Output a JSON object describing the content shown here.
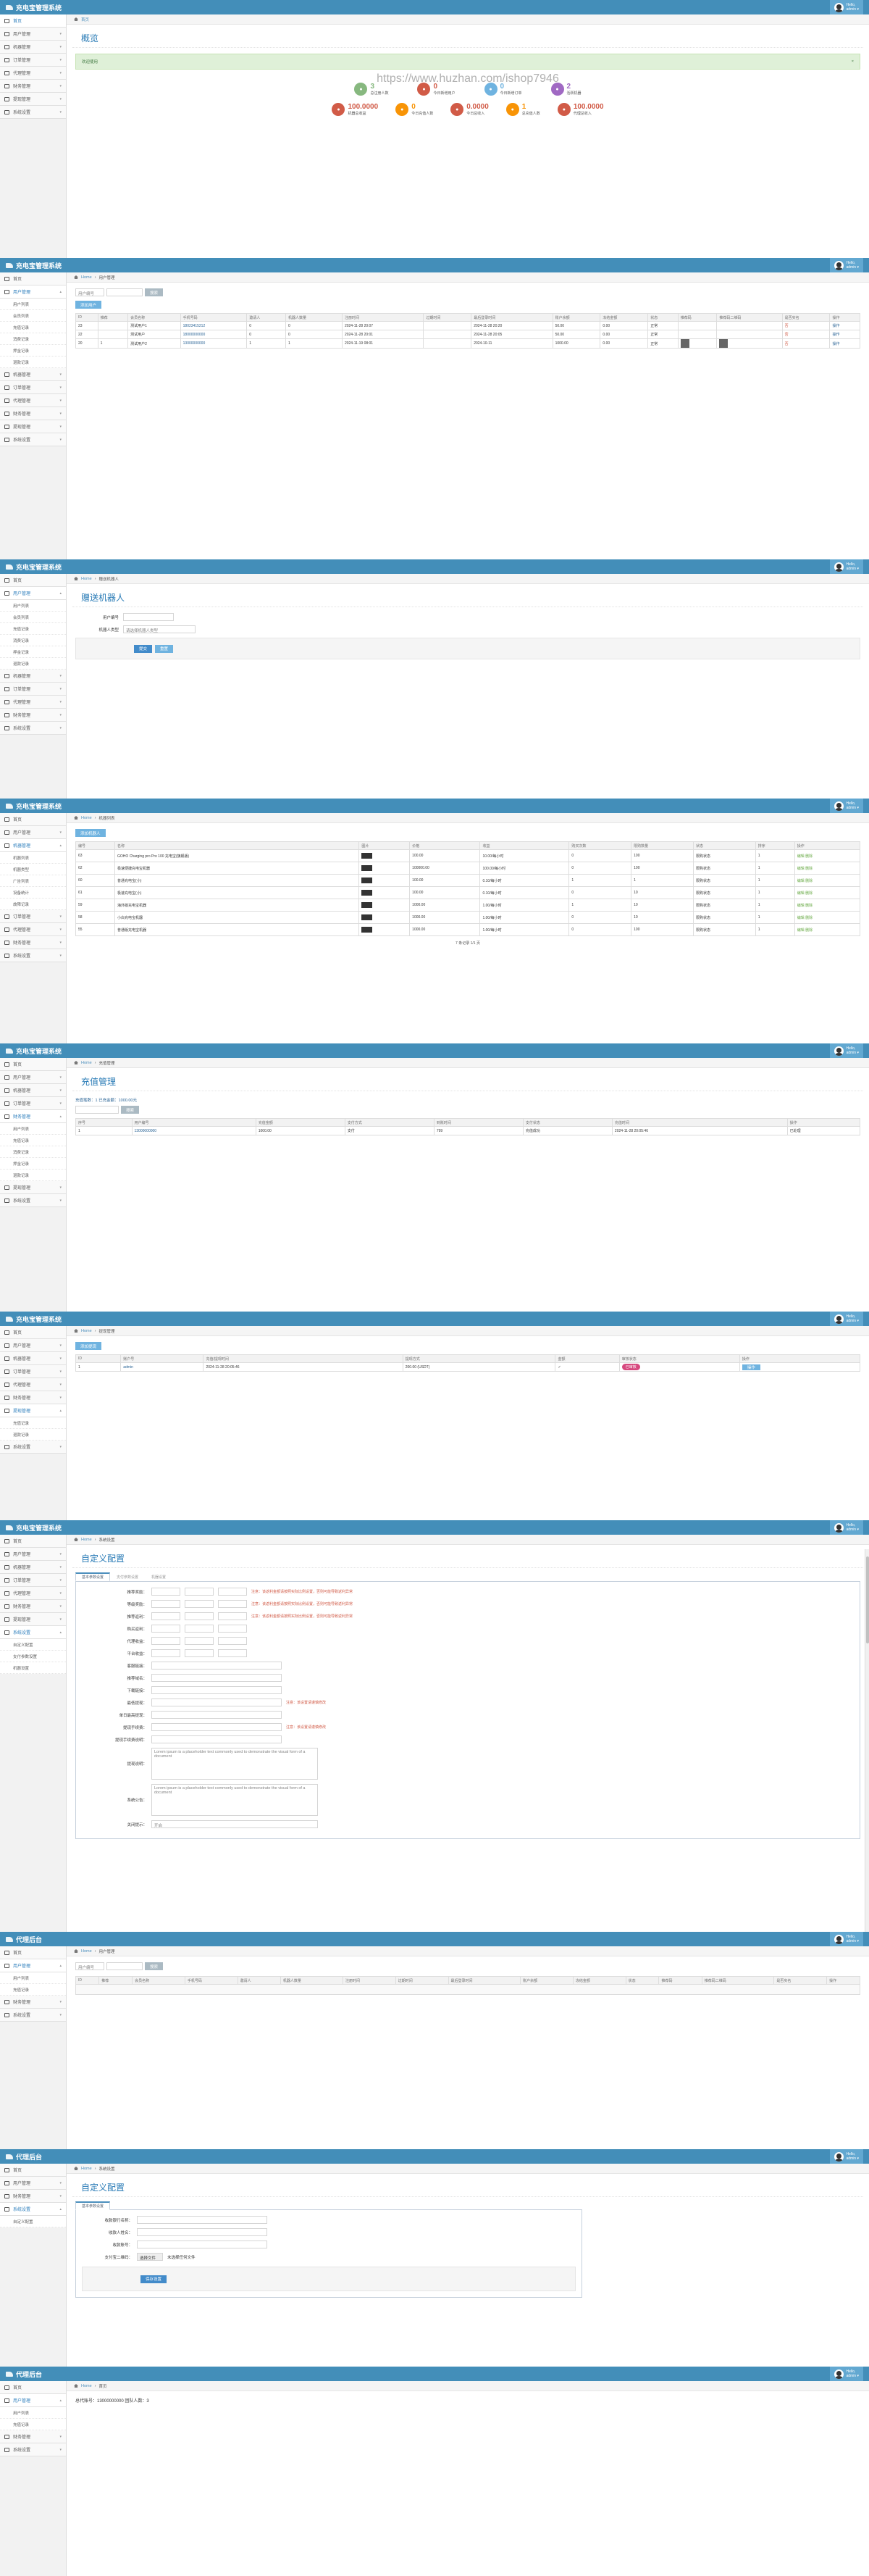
{
  "app": {
    "title": "充电宝管理系统",
    "agent_title": "代理后台",
    "user_line1": "Hello,",
    "user_line2": "admin ▾"
  },
  "watermark": "https://www.huzhan.com/ishop7946",
  "menu": {
    "home": "首页",
    "user": "用户管理",
    "device": "机器管理",
    "order": "订单管理",
    "agent": "代理管理",
    "finance": "财务管理",
    "withdraw": "提现管理",
    "system": "系统设置"
  },
  "user_sub": [
    "用户列表",
    "会员列表",
    "充值记录",
    "消费记录",
    "押金记录",
    "退款记录"
  ],
  "device_sub": [
    "机器列表",
    "机器类型",
    "广告列表",
    "设备统计",
    "故障记录"
  ],
  "crumbs": {
    "home": "Home",
    "user_list": "用户管理",
    "device_list": "机器列表",
    "recharge": "充值管理",
    "push": "赠送机器人",
    "finance": "财务管理",
    "custom": "系统设置"
  },
  "dashboard": {
    "title": "概览",
    "alert": "欢迎使用",
    "stats_top": [
      {
        "label": "总注册人数",
        "value": "3"
      },
      {
        "label": "今日新增用户",
        "value": "0"
      },
      {
        "label": "今日新增订单",
        "value": "0"
      },
      {
        "label": "活跃机器",
        "value": "2"
      }
    ],
    "stats_bottom": [
      {
        "label": "机器总收益",
        "value": "100.0000"
      },
      {
        "label": "今日充值人数",
        "value": "0"
      },
      {
        "label": "今日总收入",
        "value": "0.0000"
      },
      {
        "label": "总充值人数",
        "value": "1"
      },
      {
        "label": "代理总收入",
        "value": "100.0000"
      }
    ]
  },
  "user_list": {
    "search_select": "用户编号",
    "search_btn": "搜索",
    "add_btn": "添加用户",
    "headers": [
      "ID",
      "推荐",
      "会员名称",
      "手机号码",
      "邀请人",
      "机器人数量",
      "注册时间",
      "过期时间",
      "最后登录时间",
      "账户余额",
      "冻结金额",
      "状态",
      "推荐码",
      "推荐码二维码",
      "是否实名",
      "操作"
    ],
    "rows": [
      [
        "23",
        "",
        "测试用户1",
        "18023415212",
        "0",
        "0",
        "2024-11-28 20:07",
        "",
        "2024-11-28 20:20",
        "50.00",
        "0.00",
        "正常",
        "",
        "",
        "否",
        "操作"
      ],
      [
        "22",
        "",
        "测试用户",
        "18000000000",
        "0",
        "0",
        "2024-11-28 20:01",
        "",
        "2024-11-28 20:05",
        "50.00",
        "0.00",
        "正常",
        "",
        "",
        "否",
        "操作"
      ],
      [
        "20",
        "1",
        "测试用户2",
        "13000000000",
        "1",
        "1",
        "2024-11-19 08:01",
        "",
        "2024-10-11",
        "1000.00",
        "0.00",
        "正常",
        "图",
        "图",
        "否",
        "操作"
      ]
    ]
  },
  "push_robot": {
    "title": "赠送机器人",
    "account_label": "用户编号",
    "type_label": "机器人类型",
    "type_value": "请选择机器人类型",
    "submit": "提交",
    "reset": "重置"
  },
  "device_list": {
    "add_btn": "添加机器人",
    "headers": [
      "编号",
      "名称",
      "图片",
      "价格",
      "收益",
      "购买次数",
      "限购数量",
      "状态",
      "排序",
      "操作"
    ],
    "rows": [
      [
        "63",
        "GOHO Charging pro Pro 100 充电宝(旗舰版)",
        "",
        "100.00",
        "10.00/每小时",
        "0",
        "100",
        "限购状态",
        "1",
        "编辑 删除"
      ],
      [
        "62",
        "极速便捷充电宝机器",
        "",
        "100000.00",
        "100.00/每小时",
        "0",
        "100",
        "限购状态",
        "1",
        "编辑 删除"
      ],
      [
        "60",
        "普通充电宝(小)",
        "",
        "100.00",
        "0.10/每小时",
        "1",
        "1",
        "限购状态",
        "1",
        "编辑 删除"
      ],
      [
        "61",
        "极速充电宝(小)",
        "",
        "100.00",
        "0.10/每小时",
        "0",
        "10",
        "限购状态",
        "1",
        "编辑 删除"
      ],
      [
        "59",
        "海外版充电宝机器",
        "",
        "1000.00",
        "1.00/每小时",
        "1",
        "10",
        "限购状态",
        "1",
        "编辑 删除"
      ],
      [
        "58",
        "小白充电宝机器",
        "",
        "1000.00",
        "1.00/每小时",
        "0",
        "10",
        "限购状态",
        "1",
        "编辑 删除"
      ],
      [
        "55",
        "普通版充电宝机器",
        "",
        "1000.00",
        "1.00/每小时",
        "0",
        "100",
        "限购状态",
        "1",
        "编辑 删除"
      ]
    ],
    "pager": "7 条记录 1/1 页"
  },
  "recharge": {
    "title": "充值管理",
    "summary": "充值笔数：1    已充金额：1000.00元",
    "headers": [
      "序号",
      "用户编号",
      "充值金额",
      "支付方式",
      "到账时间",
      "支付状态",
      "充值时间",
      "操作"
    ],
    "row": [
      "1",
      "13000000000",
      "1000.00",
      "支付",
      "799",
      "充值成功",
      "2024-11-28 20:05:46",
      "已处理"
    ]
  },
  "withdraw": {
    "add_btn": "添加提现",
    "headers": [
      "ID",
      "账户号",
      "充值/提现时间",
      "提现方式",
      "金额",
      "审核状态",
      "操作"
    ],
    "row": [
      "1",
      "admin",
      "2024-11-28 20:05:46",
      "200.00 (USDT)",
      "✓",
      "已审核",
      "操作"
    ]
  },
  "custom": {
    "title": "自定义配置",
    "tabs": [
      "基本参数设置",
      "支付参数设置",
      "机器设置"
    ],
    "fields": [
      "推荐奖励：",
      "等级奖励：",
      "推荐返利：",
      "购买返利：",
      "代理收益：",
      "平台收益：",
      "客服链接：",
      "推荐域名：",
      "下载链接：",
      "最低提现：",
      "单日最高提现：",
      "提现手续费：",
      "提现手续费说明：",
      "提现说明：",
      "系统公告：",
      "关闭提示："
    ],
    "note1": "注意：该返利金额请按照实际比例设置，否则可能导致返利异常",
    "note2": "注意：该设置请谨慎修改",
    "placeholder_text": "Lorem ipsum is a placeholder text commonly used to demonstrate the visual form of a document",
    "select_value": "开启"
  },
  "agent_panels": {
    "menu": [
      "首页",
      "用户管理",
      "用户列表",
      "充值记录",
      "财务管理",
      "系统设置"
    ],
    "custom_fields": [
      "收款银行名称：",
      "收款人姓名：",
      "收款账号：",
      "支付宝二维码："
    ],
    "upload_btn": "选择文件",
    "upload_text": "未选择任何文件",
    "save_btn": "保存设置",
    "final_text": "总代账号：13000000000  团队人数：3"
  },
  "colors": {
    "nav": "#438eb9",
    "accent": "#2679b5",
    "red": "#d15b47",
    "green": "#69aa46"
  }
}
